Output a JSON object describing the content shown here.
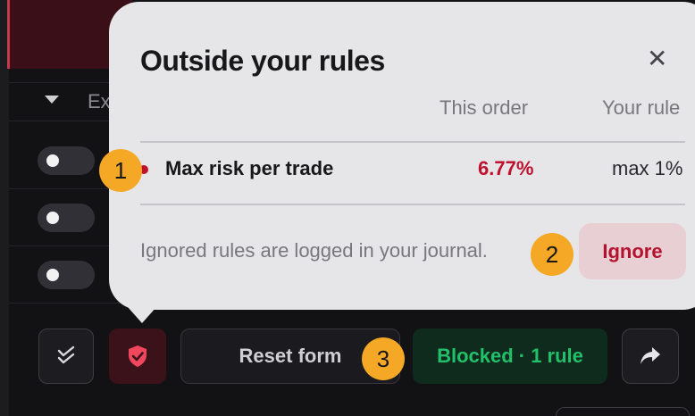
{
  "form": {
    "section_label": "Ex",
    "toggles": [
      false,
      false,
      false
    ]
  },
  "popover": {
    "title": "Outside your rules",
    "close_icon": "close-icon",
    "col_this_order": "This order",
    "col_your_rule": "Your rule",
    "violation": {
      "name": "Max risk per trade",
      "value": "6.77%",
      "limit": "max 1%"
    },
    "footnote": "Ignored rules are logged in your journal.",
    "ignore_label": "Ignore"
  },
  "toolbar": {
    "check_icon": "double-check-icon",
    "shield_icon": "shield-check-icon",
    "reset_label": "Reset form",
    "blocked_label": "Blocked · 1 rule",
    "share_icon": "share-arrow-icon"
  },
  "markers": [
    "1",
    "2",
    "3"
  ],
  "colors": {
    "danger": "#c0112e",
    "success": "#23c06a",
    "marker": "#f4a825",
    "popover_bg": "#e6e6e8"
  }
}
